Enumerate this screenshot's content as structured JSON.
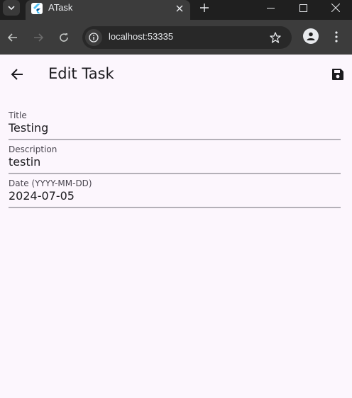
{
  "browser": {
    "tab_title": "ATask",
    "url": "localhost:53335"
  },
  "app_bar": {
    "title": "Edit Task"
  },
  "form": {
    "fields": [
      {
        "label": "Title",
        "value": "Testing"
      },
      {
        "label": "Description",
        "value": "testin"
      },
      {
        "label": "Date (YYYY-MM-DD)",
        "value": "2024-07-05"
      }
    ]
  },
  "colors": {
    "app_background": "#fcf6fd",
    "chrome_dark": "#1f1f1f",
    "toolbar": "#3c3c3c",
    "text_primary": "#1c1b1f",
    "underline": "#b4b0b8"
  },
  "icons": [
    "tab-search-icon",
    "flutter-icon",
    "close-icon",
    "plus-icon",
    "minimize-icon",
    "maximize-icon",
    "window-close-icon",
    "back-arrow-icon",
    "forward-arrow-icon",
    "reload-icon",
    "site-info-icon",
    "star-icon",
    "profile-icon",
    "more-vert-icon",
    "save-icon"
  ]
}
